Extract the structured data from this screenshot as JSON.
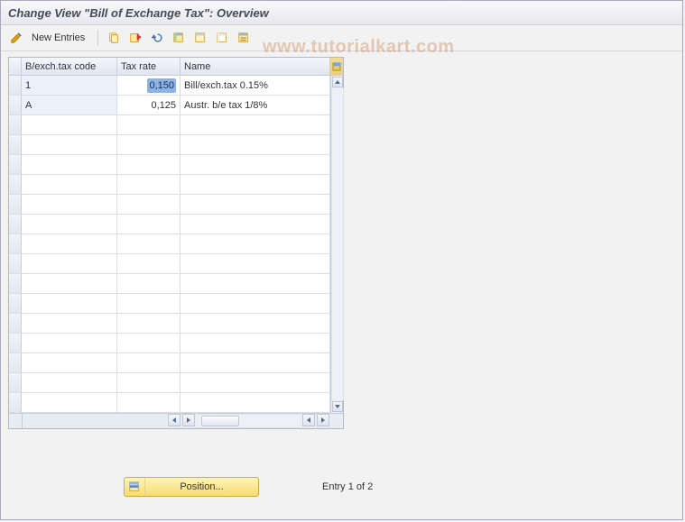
{
  "title": "Change View \"Bill of Exchange Tax\": Overview",
  "watermark": "www.tutorialkart.com",
  "toolbar": {
    "edit_icon": "pencil-icon",
    "new_entries_label": "New Entries",
    "copy_icon": "copy-icon",
    "delete_icon": "delete-icon",
    "undo_icon": "undo-icon",
    "select_all_icon": "select-all-icon",
    "select_block_icon": "deselect-all-icon",
    "config_icon": "table-settings-icon"
  },
  "grid": {
    "columns": {
      "code": "B/exch.tax code",
      "rate": "Tax rate",
      "name": "Name"
    },
    "rows": [
      {
        "code": "1",
        "rate": "0,150",
        "rate_selected": true,
        "name": "Bill/exch.tax 0.15%"
      },
      {
        "code": "A",
        "rate": "0,125",
        "rate_selected": false,
        "name": "Austr. b/e tax 1/8%"
      }
    ],
    "empty_row_count": 15
  },
  "footer": {
    "position_label": "Position...",
    "entry_text": "Entry 1 of 2"
  }
}
